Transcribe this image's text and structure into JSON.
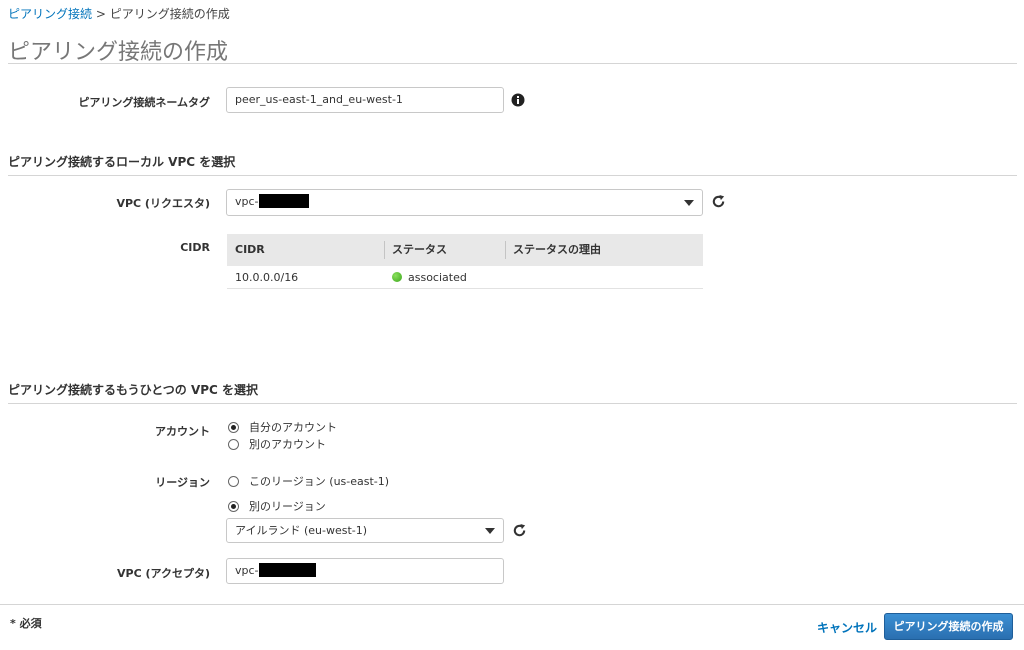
{
  "breadcrumb": {
    "link": "ピアリング接続",
    "separator": " > ",
    "current": "ピアリング接続の作成"
  },
  "page_title": "ピアリング接続の作成",
  "name_tag": {
    "label": "ピアリング接続ネームタグ",
    "value": "peer_us-east-1_and_eu-west-1",
    "icon": "info-icon"
  },
  "local_section": {
    "title": "ピアリング接続するローカル VPC を選択",
    "vpc_label": "VPC (リクエスタ)",
    "vpc_value": "vpc-",
    "cidr_label": "CIDR",
    "table": {
      "headers": [
        "CIDR",
        "ステータス",
        "ステータスの理由"
      ],
      "rows": [
        {
          "cidr": "10.0.0.0/16",
          "status": "associated",
          "reason": "",
          "status_color": "#3aa61a"
        }
      ]
    }
  },
  "peer_section": {
    "title": "ピアリング接続するもうひとつの VPC を選択",
    "account_label": "アカウント",
    "account_options": [
      {
        "label": "自分のアカウント",
        "checked": true
      },
      {
        "label": "別のアカウント",
        "checked": false
      }
    ],
    "region_label": "リージョン",
    "region_options": [
      {
        "label": "このリージョン (us-east-1)",
        "checked": false
      },
      {
        "label": "別のリージョン",
        "checked": true
      }
    ],
    "region_select": "アイルランド (eu-west-1)",
    "vpc_label": "VPC (アクセプタ)",
    "vpc_value": "vpc-"
  },
  "footer": {
    "required": "* 必須",
    "cancel": "キャンセル",
    "create": "ピアリング接続の作成"
  },
  "colors": {
    "link": "#0073bb",
    "primary_button": "#2a6fb0",
    "status_ok": "#3aa61a"
  }
}
